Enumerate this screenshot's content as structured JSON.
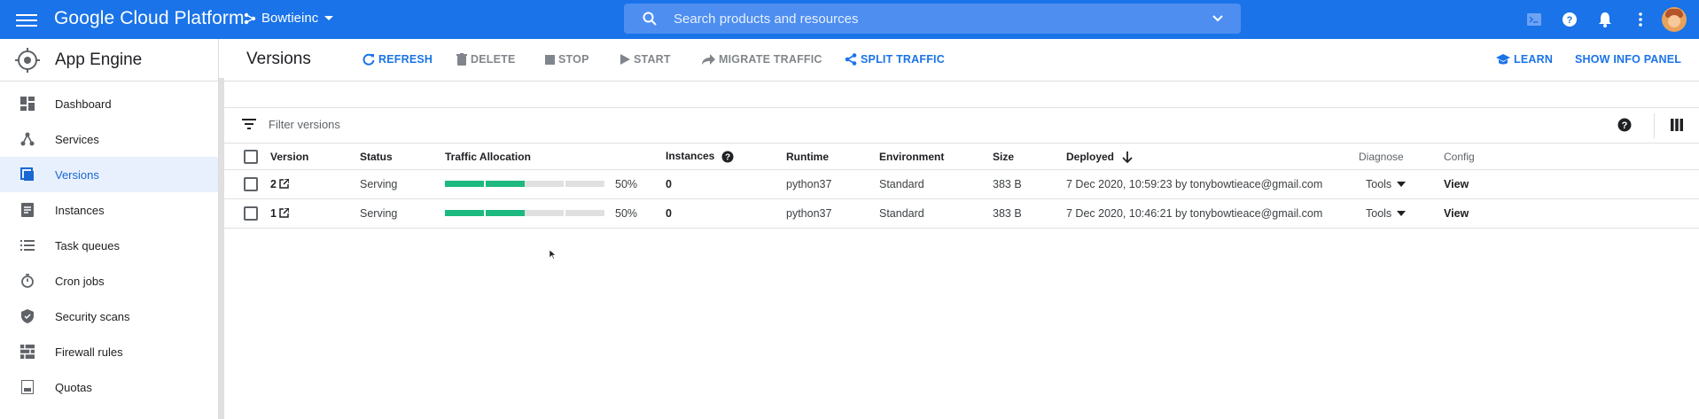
{
  "topbar": {
    "brand": "Google Cloud Platform",
    "project": "Bowtieinc",
    "search_placeholder": "Search products and resources",
    "icons": [
      "menu-icon",
      "terminal-icon",
      "help-icon",
      "notifications-icon",
      "more-vert-icon",
      "avatar"
    ],
    "color": "#1a73e8"
  },
  "sidebar": {
    "product": "App Engine",
    "items": [
      {
        "label": "Dashboard",
        "icon": "dashboard-icon"
      },
      {
        "label": "Services",
        "icon": "services-icon"
      },
      {
        "label": "Versions",
        "icon": "versions-icon",
        "active": true
      },
      {
        "label": "Instances",
        "icon": "instances-icon"
      },
      {
        "label": "Task queues",
        "icon": "task-queues-icon"
      },
      {
        "label": "Cron jobs",
        "icon": "cron-icon"
      },
      {
        "label": "Security scans",
        "icon": "shield-icon"
      },
      {
        "label": "Firewall rules",
        "icon": "firewall-icon"
      },
      {
        "label": "Quotas",
        "icon": "quotas-icon"
      }
    ]
  },
  "toolbar": {
    "title": "Versions",
    "refresh": "REFRESH",
    "delete": "DELETE",
    "stop": "STOP",
    "start": "START",
    "migrate": "MIGRATE TRAFFIC",
    "split": "SPLIT TRAFFIC",
    "learn": "LEARN",
    "info_panel": "SHOW INFO PANEL"
  },
  "filter": {
    "placeholder": "Filter versions"
  },
  "table": {
    "headers": {
      "version": "Version",
      "status": "Status",
      "traffic": "Traffic Allocation",
      "instances": "Instances",
      "runtime": "Runtime",
      "environment": "Environment",
      "size": "Size",
      "deployed": "Deployed",
      "diagnose": "Diagnose",
      "config": "Config"
    },
    "rows": [
      {
        "version": "2",
        "status": "Serving",
        "traffic_pct": 50,
        "traffic_label": "50%",
        "instances": "0",
        "runtime": "python37",
        "environment": "Standard",
        "size": "383 B",
        "deployed": "7 Dec 2020, 10:59:23 by tonybowtieace@gmail.com",
        "diagnose": "Tools",
        "config": "View"
      },
      {
        "version": "1",
        "status": "Serving",
        "traffic_pct": 50,
        "traffic_label": "50%",
        "instances": "0",
        "runtime": "python37",
        "environment": "Standard",
        "size": "383 B",
        "deployed": "7 Dec 2020, 10:46:21 by tonybowtieace@gmail.com",
        "diagnose": "Tools",
        "config": "View"
      }
    ]
  },
  "colors": {
    "accent": "#1a73e8",
    "traffic": "#1eb980",
    "active_bg": "#e8f0fe"
  }
}
